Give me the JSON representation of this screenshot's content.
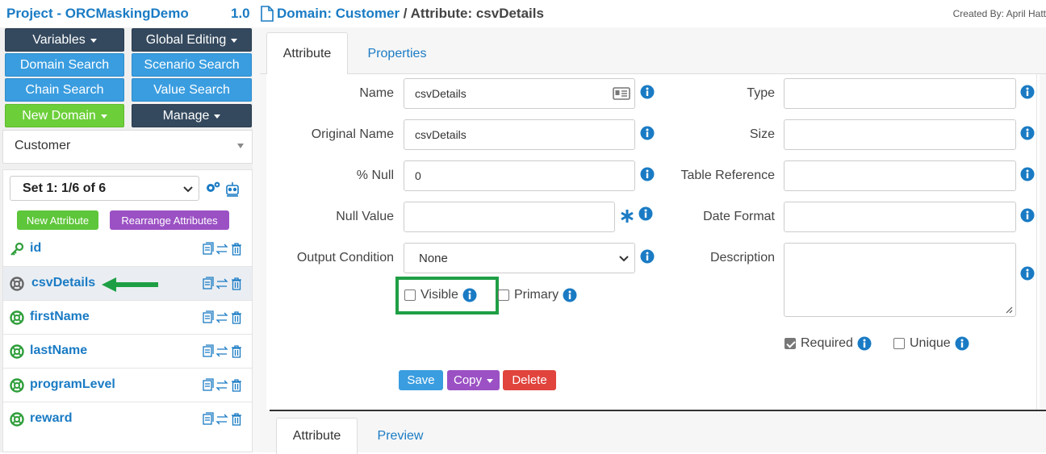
{
  "header": {
    "project_title": "Project - ORCMaskingDemo",
    "version": "1.0",
    "breadcrumb_domain": "Domain: Customer",
    "breadcrumb_sep": " / ",
    "breadcrumb_attribute": "Attribute: csvDetails",
    "created_by": "Created By: April Hatt"
  },
  "sidebar": {
    "buttons": {
      "variables": "Variables",
      "global_editing": "Global Editing",
      "domain_search": "Domain Search",
      "scenario_search": "Scenario Search",
      "chain_search": "Chain Search",
      "value_search": "Value Search",
      "new_domain": "New Domain",
      "manage": "Manage"
    },
    "domain_select": "Customer",
    "set_select": "Set 1: 1/6 of 6",
    "new_attribute": "New Attribute",
    "rearrange_attributes": "Rearrange Attributes",
    "attributes": [
      {
        "label": "id",
        "icon": "key-icon"
      },
      {
        "label": "csvDetails",
        "icon": "lifebuoy-icon"
      },
      {
        "label": "firstName",
        "icon": "lifebuoy-icon"
      },
      {
        "label": "lastName",
        "icon": "lifebuoy-icon"
      },
      {
        "label": "programLevel",
        "icon": "lifebuoy-icon"
      },
      {
        "label": "reward",
        "icon": "lifebuoy-icon"
      }
    ]
  },
  "main": {
    "tabs": [
      "Attribute",
      "Properties"
    ],
    "form": {
      "name_label": "Name",
      "name_value": "csvDetails",
      "original_name_label": "Original Name",
      "original_name_value": "csvDetails",
      "pct_null_label": "% Null",
      "pct_null_value": "0",
      "null_value_label": "Null Value",
      "null_value_value": "",
      "output_condition_label": "Output Condition",
      "output_condition_value": "None",
      "visible_label": "Visible",
      "primary_label": "Primary",
      "type_label": "Type",
      "size_label": "Size",
      "table_reference_label": "Table Reference",
      "date_format_label": "Date Format",
      "description_label": "Description",
      "required_label": "Required",
      "unique_label": "Unique"
    },
    "checks": {
      "visible": false,
      "primary": false,
      "required": true,
      "unique": false
    },
    "actions": {
      "save": "Save",
      "copy": "Copy",
      "delete": "Delete"
    },
    "bottom_tabs": [
      "Attribute",
      "Preview"
    ]
  },
  "colors": {
    "accent_blue": "#1a7bc4",
    "button_blue": "#3a9de0",
    "button_dark": "#34495e",
    "button_green": "#6ccf3a",
    "button_purple": "#9b51c4",
    "button_red": "#e0443d",
    "highlight_green": "#1f9f45"
  }
}
